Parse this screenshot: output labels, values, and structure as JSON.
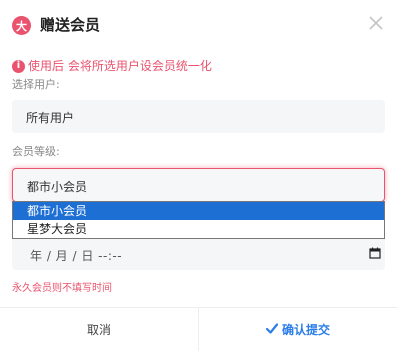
{
  "header": {
    "logo_text": "大",
    "title": "赠送会员",
    "accent_color": "#e9536e"
  },
  "notice": {
    "icon": "info-icon",
    "text": "使用后 会将所选用户设会员统一化"
  },
  "user_select": {
    "label": "选择用户:",
    "value": "所有用户"
  },
  "level_select": {
    "label": "会员等级:",
    "value": "都市小会员",
    "options": [
      "都市小会员",
      "星梦大会员"
    ],
    "selected_index": 0
  },
  "date_input": {
    "value": "年 / 月 / 日  --:--",
    "icon": "calendar-icon"
  },
  "hint": "永久会员则不填写时间",
  "footer": {
    "cancel_label": "取消",
    "confirm_label": "确认提交",
    "confirm_icon": "check-icon",
    "confirm_color": "#2b7de9"
  }
}
